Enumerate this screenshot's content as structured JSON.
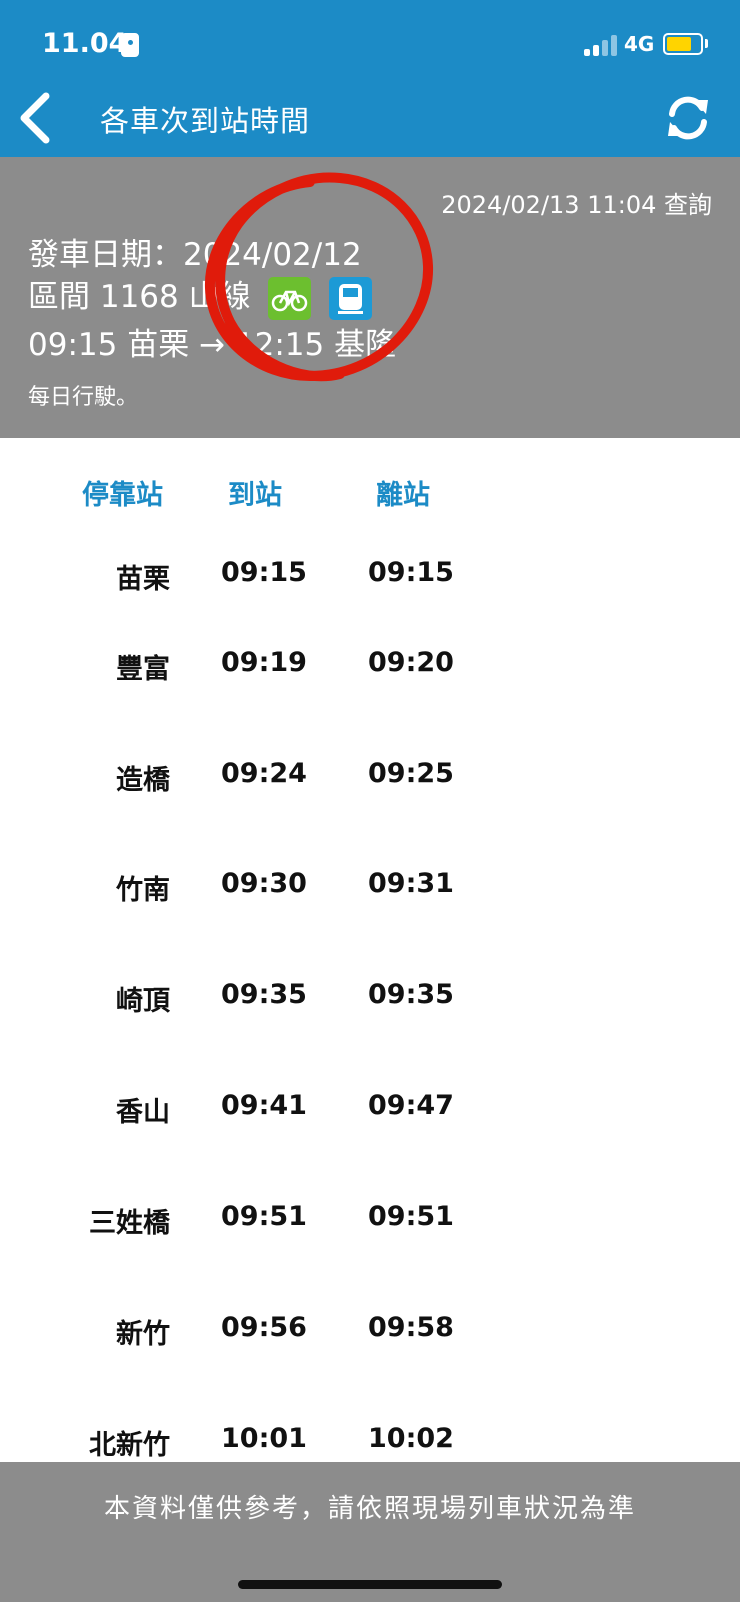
{
  "status": {
    "time": "11.04",
    "network": "4G"
  },
  "header": {
    "title": "各車次到站時間",
    "back_icon": "chevron-left-icon",
    "refresh_icon": "refresh-icon"
  },
  "info": {
    "query_time": "2024/02/13 11:04 查詢",
    "departure_date": "發車日期：2024/02/12",
    "train_prefix": "區間 1168 山線",
    "route": "09:15 苗栗 → 12:15 基隆",
    "operating": "每日行駛。",
    "bike_color": "#6cbf2f",
    "train_icon_color": "#1c9ad6",
    "annotation_color": "#e01b0b"
  },
  "table": {
    "headers": {
      "station": "停靠站",
      "arrive": "到站",
      "depart": "離站"
    },
    "rows": [
      {
        "station": "苗栗",
        "arrive": "09:15",
        "depart": "09:15"
      },
      {
        "station": "豐富",
        "arrive": "09:19",
        "depart": "09:20"
      },
      {
        "station": "造橋",
        "arrive": "09:24",
        "depart": "09:25"
      },
      {
        "station": "竹南",
        "arrive": "09:30",
        "depart": "09:31"
      },
      {
        "station": "崎頂",
        "arrive": "09:35",
        "depart": "09:35"
      },
      {
        "station": "香山",
        "arrive": "09:41",
        "depart": "09:47"
      },
      {
        "station": "三姓橋",
        "arrive": "09:51",
        "depart": "09:51"
      },
      {
        "station": "新竹",
        "arrive": "09:56",
        "depart": "09:58"
      },
      {
        "station": "北新竹",
        "arrive": "10:01",
        "depart": "10:02"
      }
    ]
  },
  "footer": {
    "notice": "本資料僅供參考，請依照現場列車狀況為準"
  },
  "colors": {
    "header": "#1c8bc6",
    "info_bg": "#8c8c8c"
  },
  "battery_level": 0.75
}
